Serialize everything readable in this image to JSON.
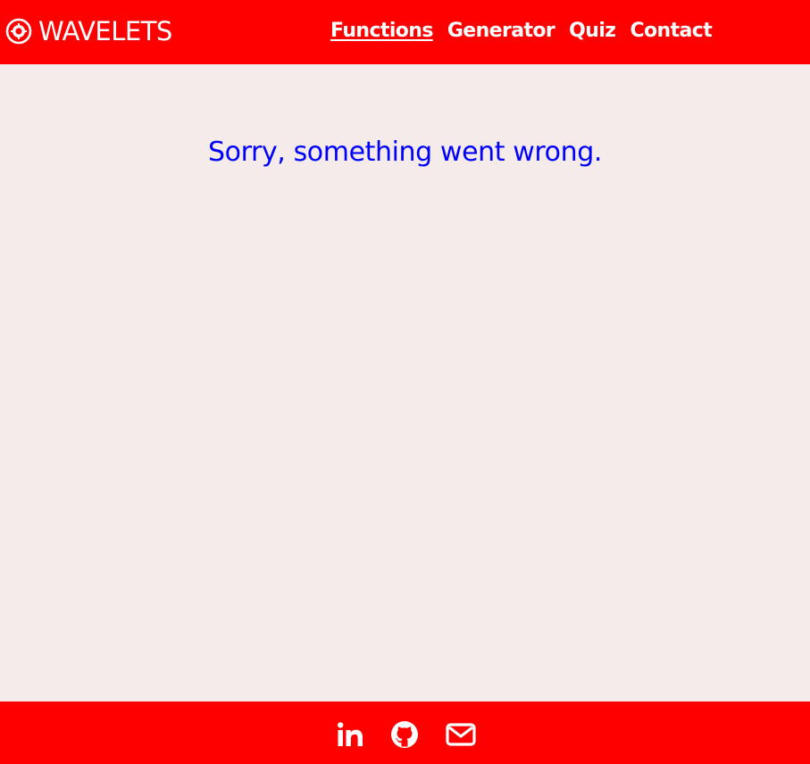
{
  "header": {
    "brand": {
      "text": "WAVELETS",
      "icon": "logo-icon"
    },
    "nav": [
      {
        "label": "Functions",
        "active": true
      },
      {
        "label": "Generator",
        "active": false
      },
      {
        "label": "Quiz",
        "active": false
      },
      {
        "label": "Contact",
        "active": false
      }
    ]
  },
  "main": {
    "message": "Sorry, something went wrong."
  },
  "footer": {
    "social": [
      {
        "icon": "linkedin-icon"
      },
      {
        "icon": "github-icon"
      },
      {
        "icon": "mail-icon"
      }
    ]
  },
  "colors": {
    "header_bg": "#FF0000",
    "footer_bg": "#FF0000",
    "page_bg": "#F6EBEB",
    "message": "#0000FF",
    "header_text": "#FFFFFF"
  }
}
